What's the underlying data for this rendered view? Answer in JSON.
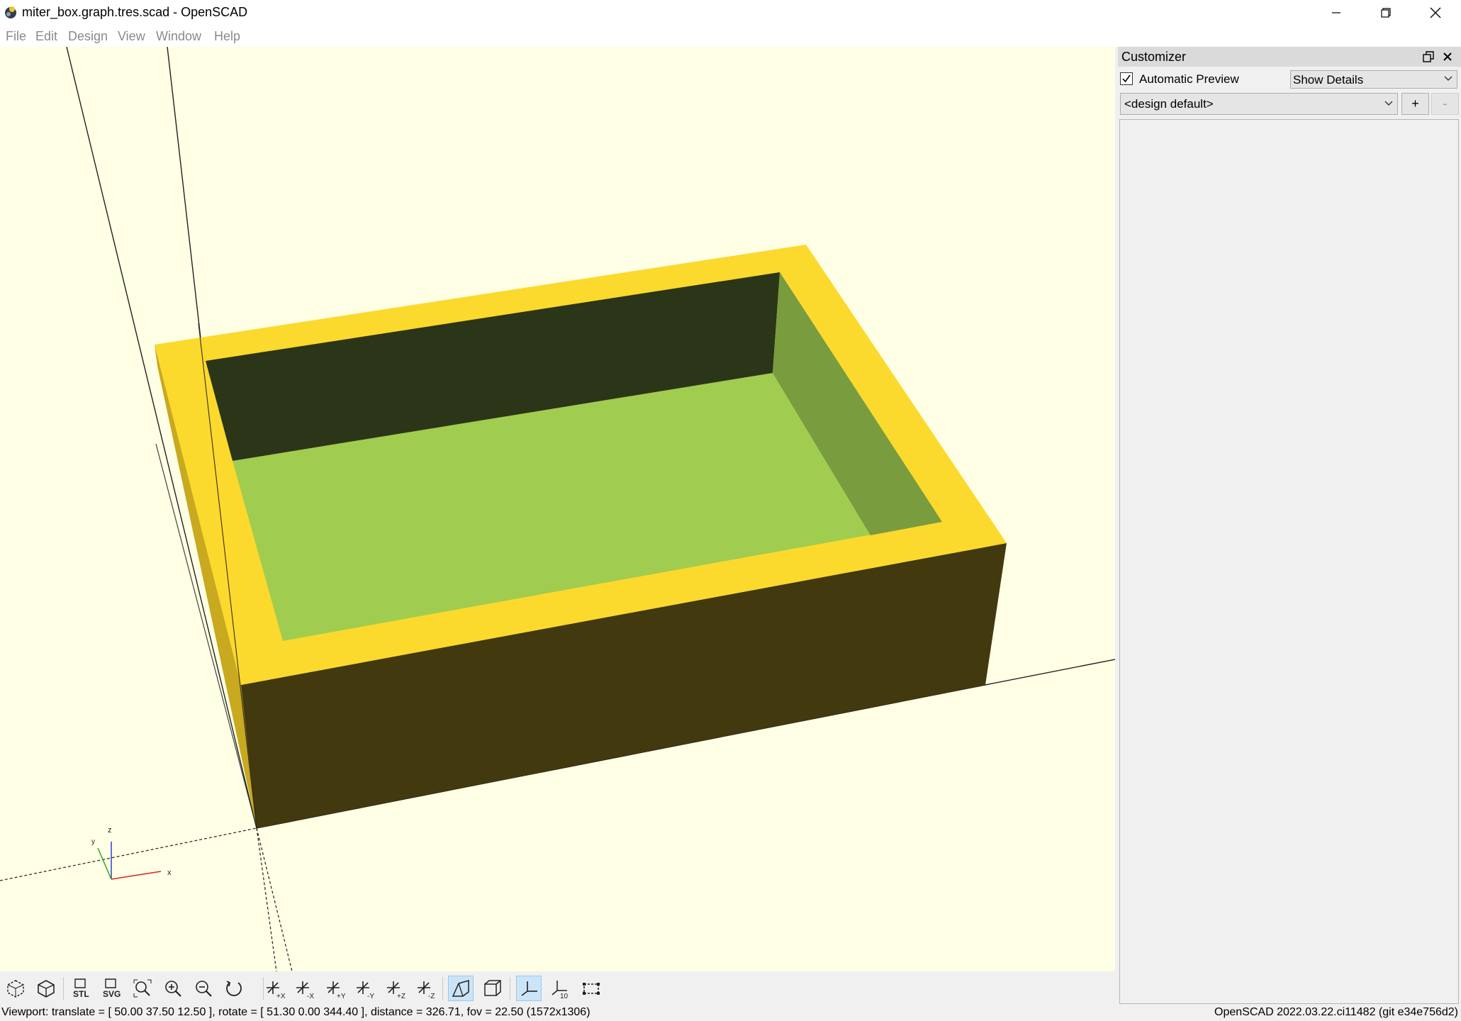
{
  "window": {
    "title": "miter_box.graph.tres.scad - OpenSCAD",
    "icon": "openscad-icon",
    "controls": [
      "minimize-icon",
      "maximize-icon",
      "close-icon"
    ]
  },
  "menu": [
    "File",
    "Edit",
    "Design",
    "View",
    "Window",
    "Help"
  ],
  "viewport": {
    "background": "#ffffe5",
    "model_colors": {
      "rim_top": "#fcd92d",
      "front_wall": "#42390e",
      "left_wall": "#c8a91f",
      "inner_floor": "#a0cc50",
      "inner_back_wall": "#2b3518",
      "inner_right_wall": "#789c3e"
    },
    "axis_labels": {
      "x": "x",
      "y": "y",
      "z": "z"
    }
  },
  "toolbar": {
    "buttons": [
      "preview-icon",
      "render-icon",
      "export-stl-icon",
      "export-svg-icon",
      "view-all-icon",
      "zoom-in-icon",
      "zoom-out-icon",
      "reset-view-icon",
      "view-right-icon",
      "view-left-icon",
      "view-back-icon",
      "view-front-icon",
      "view-top-icon",
      "view-bottom-icon",
      "perspective-icon",
      "orthogonal-icon",
      "show-axes-icon",
      "show-scale-markers-icon",
      "show-edges-icon"
    ],
    "stl_label": "STL",
    "svg_label": "SVG"
  },
  "status": {
    "viewport_info": "Viewport: translate = [ 50.00 37.50 12.50 ], rotate = [ 51.30 0.00 344.40 ], distance = 326.71, fov = 22.50 (1572x1306)",
    "version": "OpenSCAD 2022.03.22.ci11482 (git e34e756d2)"
  },
  "customizer": {
    "title": "Customizer",
    "automatic_preview_label": "Automatic Preview",
    "automatic_preview_checked": true,
    "details_value": "Show Details",
    "preset_value": "<design default>",
    "add_label": "+",
    "remove_label": "-"
  }
}
